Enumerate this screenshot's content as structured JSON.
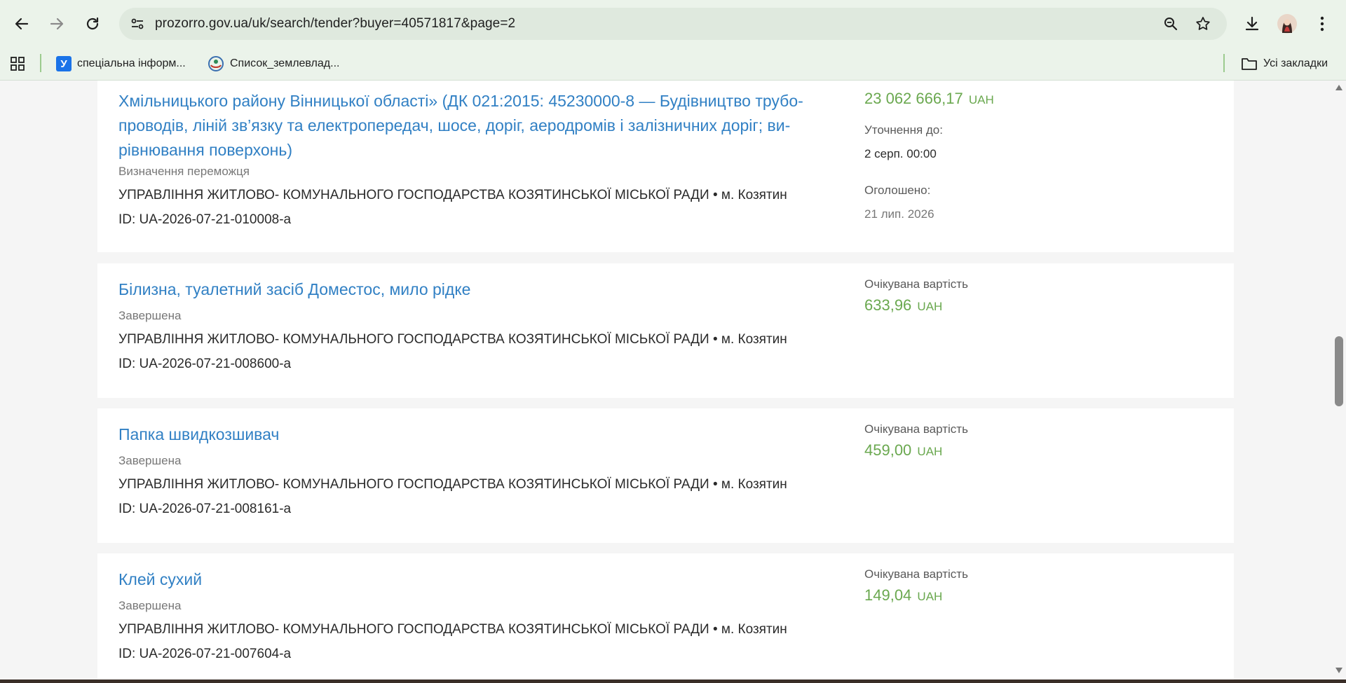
{
  "browser": {
    "url": "prozorro.gov.ua/uk/search/tender?buyer=40571817&page=2",
    "bookmarks": [
      {
        "label": "спеціальна інформ...",
        "icon_text": "У"
      },
      {
        "label": "Список_землевлад..."
      }
    ],
    "all_bookmarks_label": "Усі закладки"
  },
  "tenders": [
    {
      "title": "Хмільницького району Вінницької області» (ДК 021:2015: 45230000-8 — Будівництво трубо-проводів, ліній зв’язку та електропередач, шосе, доріг, аеродромів і залізничних доріг; ви-рівнювання поверхонь)",
      "title_lines": [
        "Хмільницького району Вінницької області» (ДК 021:2015: 45230000-8 — Будівництво трубо-",
        "проводів, ліній зв’язку та електропередач, шосе, доріг, аеродромів і залізничних доріг; ви-",
        "рівнювання поверхонь)"
      ],
      "status": "Визначення переможця",
      "buyer": "УПРАВЛІННЯ ЖИТЛОВО- КОМУНАЛЬНОГО ГОСПОДАРСТВА КОЗЯТИНСЬКОЇ МІСЬКОЇ РАДИ • м. Козятин",
      "id": "ID: UA-2026-07-21-010008-a",
      "amount": "23 062 666,17",
      "currency": "UAH",
      "clarification_label": "Уточнення до:",
      "clarification_value": "2 серп. 00:00",
      "announced_label": "Оголошено:",
      "announced_value": "21 лип. 2026"
    },
    {
      "title": "Білизна, туалетний засіб Доместос, мило рідке",
      "status": "Завершена",
      "buyer": "УПРАВЛІННЯ ЖИТЛОВО- КОМУНАЛЬНОГО ГОСПОДАРСТВА КОЗЯТИНСЬКОЇ МІСЬКОЇ РАДИ • м. Козятин",
      "id": "ID: UA-2026-07-21-008600-a",
      "expected_label": "Очікувана вартість",
      "amount": "633,96",
      "currency": "UAH"
    },
    {
      "title": "Папка швидкозшивач",
      "status": "Завершена",
      "buyer": "УПРАВЛІННЯ ЖИТЛОВО- КОМУНАЛЬНОГО ГОСПОДАРСТВА КОЗЯТИНСЬКОЇ МІСЬКОЇ РАДИ • м. Козятин",
      "id": "ID: UA-2026-07-21-008161-a",
      "expected_label": "Очікувана вартість",
      "amount": "459,00",
      "currency": "UAH"
    },
    {
      "title": "Клей сухий",
      "status": "Завершена",
      "buyer": "УПРАВЛІННЯ ЖИТЛОВО- КОМУНАЛЬНОГО ГОСПОДАРСТВА КОЗЯТИНСЬКОЇ МІСЬКОЇ РАДИ • м. Козятин",
      "id": "ID: UA-2026-07-21-007604-a",
      "expected_label": "Очікувана вартість",
      "amount": "149,04",
      "currency": "UAH"
    }
  ],
  "colors": {
    "link": "#3180c4",
    "amount": "#6aa84f",
    "chrome_bg": "#ebf3ea"
  }
}
